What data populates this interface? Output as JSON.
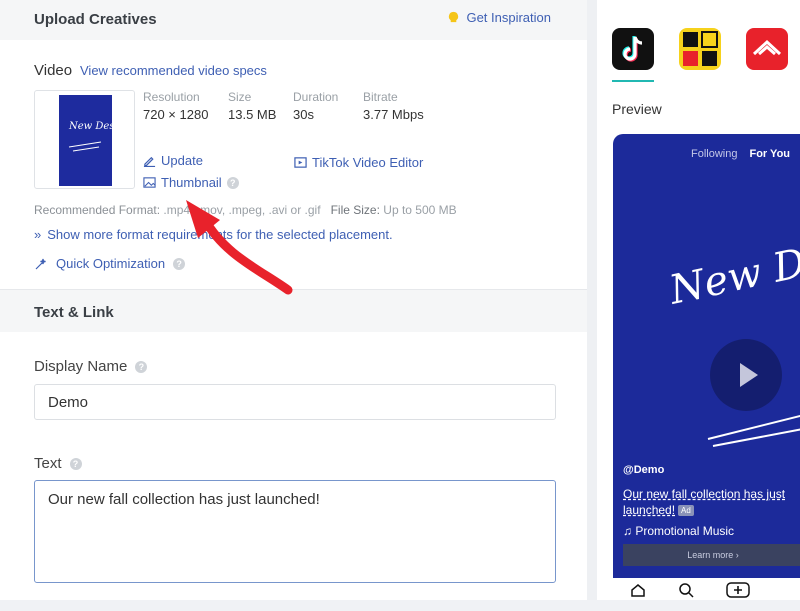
{
  "upload": {
    "title": "Upload Creatives",
    "inspiration_label": "Get Inspiration",
    "video_label": "Video",
    "video_specs_link": "View recommended video specs",
    "thumbnail_art": "New Designs!",
    "resolution_label": "Resolution",
    "resolution_value": "720 × 1280",
    "size_label": "Size",
    "size_value": "13.5 MB",
    "duration_label": "Duration",
    "duration_value": "30s",
    "bitrate_label": "Bitrate",
    "bitrate_value": "3.77 Mbps",
    "update_label": "Update",
    "editor_label": "TikTok Video Editor",
    "thumbnail_label": "Thumbnail",
    "rec_format_label": "Recommended Format:",
    "rec_format_value": ".mp4, .mov, .mpeg, .avi or .gif",
    "file_size_label": "File Size:",
    "file_size_value": "Up to 500 MB",
    "show_more": "Show more format requirements for the selected placement.",
    "quick_opt": "Quick Optimization"
  },
  "text_link": {
    "title": "Text & Link",
    "display_name_label": "Display Name",
    "display_name_value": "Demo",
    "text_label": "Text",
    "text_value": "Our new fall collection has just launched!"
  },
  "preview": {
    "label": "Preview",
    "apps": [
      "TikTok",
      "TopBuzz",
      "Pangle"
    ],
    "tab_following": "Following",
    "tab_for_you": "For You",
    "video_art": "New Designs!",
    "handle": "@Demo",
    "caption": "Our new fall collection has just launched!",
    "ad_badge": "Ad",
    "music": "♫ Promotional Music",
    "learn_more": "Learn more ›"
  },
  "colors": {
    "link": "#3e5fb3",
    "accent_teal": "#21b8b2",
    "annotation_arrow": "#e8222b",
    "video_bg": "#1c2a9a"
  }
}
